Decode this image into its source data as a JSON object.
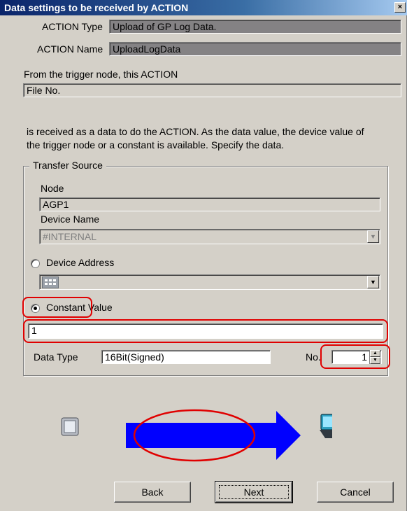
{
  "dialog": {
    "title": "Data settings to be received by ACTION",
    "close_glyph": "×"
  },
  "action": {
    "type_label": "ACTION Type",
    "type_value": "Upload of GP Log Data.",
    "name_label": "ACTION Name",
    "name_value": "UploadLogData"
  },
  "trigger": {
    "intro": "From the trigger node, this ACTION",
    "data_field": "File No.",
    "description": "is received as a data to do the ACTION. As the data value, the device value of the trigger node or a constant is available. Specify the data."
  },
  "transfer_source": {
    "title": "Transfer Source",
    "node_label": "Node",
    "node_value": "AGP1",
    "device_name_label": "Device Name",
    "device_name_value": "#INTERNAL",
    "device_address_label": "Device Address",
    "device_address_value": "",
    "constant_label": "Constant Value",
    "constant_value": "1",
    "selected_option": "Constant Value",
    "data_type_label": "Data Type",
    "data_type_value": "16Bit(Signed)",
    "no_label": "No.",
    "no_value": "1"
  },
  "icons": {
    "source": "monitor-icon",
    "target": "terminal-icon",
    "flow": "arrow-right-icon",
    "address_picker": "keypad-icon",
    "dropdown": "chevron-down-icon"
  },
  "colors": {
    "title_bar": "#0a246a",
    "arrow": "#0000ff",
    "highlight": "#e00000",
    "readonly_field": "#848284"
  },
  "buttons": {
    "back": "Back",
    "next": "Next",
    "cancel": "Cancel"
  }
}
